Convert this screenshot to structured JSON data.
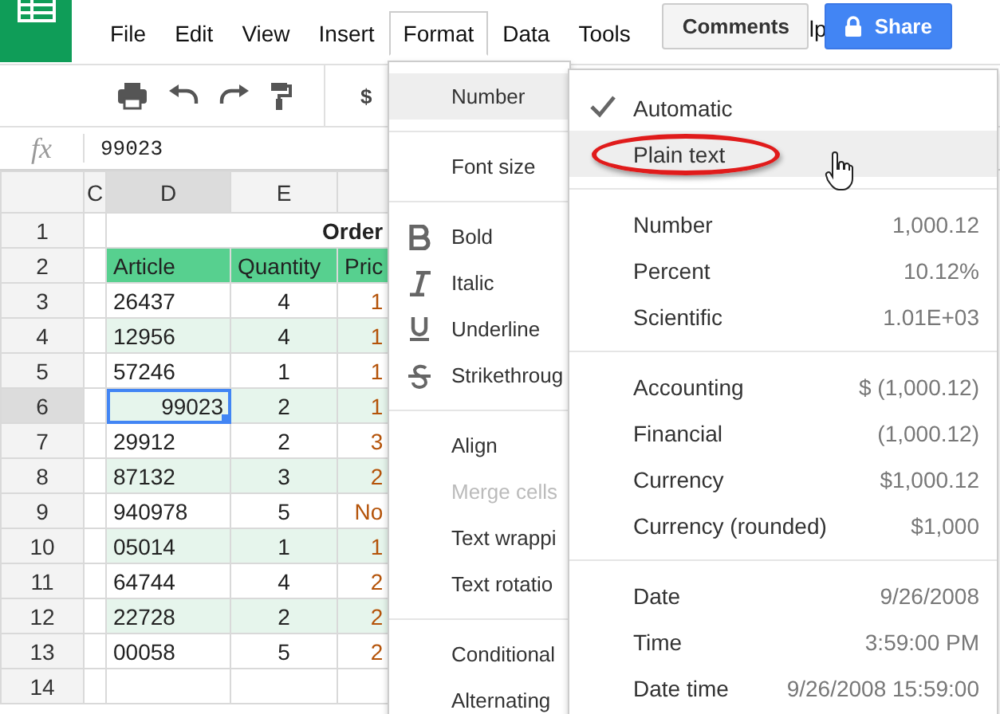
{
  "menubar": {
    "items": [
      {
        "label": "File",
        "open": false
      },
      {
        "label": "Edit",
        "open": false
      },
      {
        "label": "View",
        "open": false
      },
      {
        "label": "Insert",
        "open": false
      },
      {
        "label": "Format",
        "open": true
      },
      {
        "label": "Data",
        "open": false
      },
      {
        "label": "Tools",
        "open": false
      }
    ],
    "comments_button": "Comments",
    "partial_menu": "lp",
    "share_button": "Share"
  },
  "toolbar": {
    "currency_label": "$"
  },
  "formula_bar": {
    "label": "fx",
    "value": "99023"
  },
  "sheet": {
    "columns": [
      {
        "label": "C",
        "selected": false
      },
      {
        "label": "D",
        "selected": true
      },
      {
        "label": "E",
        "selected": false
      }
    ],
    "title_row": {
      "number": "1",
      "text": "Order"
    },
    "header_row": {
      "number": "2",
      "cells": [
        "Article",
        "Quantity",
        "Pric"
      ]
    },
    "rows": [
      {
        "number": "3",
        "selected": false,
        "article": {
          "text": "26437",
          "kind": "text"
        },
        "quantity": "4",
        "price": "1"
      },
      {
        "number": "4",
        "selected": false,
        "article": {
          "text": "12956",
          "kind": "text"
        },
        "quantity": "4",
        "price": "1"
      },
      {
        "number": "5",
        "selected": false,
        "article": {
          "text": "57246",
          "kind": "text"
        },
        "quantity": "1",
        "price": "1"
      },
      {
        "number": "6",
        "selected": true,
        "article": {
          "text": "99023",
          "kind": "number"
        },
        "quantity": "2",
        "price": "1"
      },
      {
        "number": "7",
        "selected": false,
        "article": {
          "text": "29912",
          "kind": "text"
        },
        "quantity": "2",
        "price": "3"
      },
      {
        "number": "8",
        "selected": false,
        "article": {
          "text": "87132",
          "kind": "text"
        },
        "quantity": "3",
        "price": "2"
      },
      {
        "number": "9",
        "selected": false,
        "article": {
          "text": "940978",
          "kind": "text"
        },
        "quantity": "5",
        "price": "No"
      },
      {
        "number": "10",
        "selected": false,
        "article": {
          "text": "05014",
          "kind": "text"
        },
        "quantity": "1",
        "price": "1"
      },
      {
        "number": "11",
        "selected": false,
        "article": {
          "text": "64744",
          "kind": "text"
        },
        "quantity": "4",
        "price": "2"
      },
      {
        "number": "12",
        "selected": false,
        "article": {
          "text": "22728",
          "kind": "text"
        },
        "quantity": "2",
        "price": "2"
      },
      {
        "number": "13",
        "selected": false,
        "article": {
          "text": "00058",
          "kind": "text"
        },
        "quantity": "5",
        "price": "2"
      }
    ],
    "empty_row_number": "14"
  },
  "format_menu": {
    "sections": [
      [
        {
          "label": "Number",
          "kind": "plain",
          "highlighted": true,
          "disabled": false
        }
      ],
      [
        {
          "label": "Font size",
          "kind": "plain",
          "highlighted": false,
          "disabled": false
        }
      ],
      [
        {
          "label": "Bold",
          "kind": "bold",
          "highlighted": false,
          "disabled": false
        },
        {
          "label": "Italic",
          "kind": "italic",
          "highlighted": false,
          "disabled": false
        },
        {
          "label": "Underline",
          "kind": "underline",
          "highlighted": false,
          "disabled": false
        },
        {
          "label": "Strikethroug",
          "kind": "strikethrough",
          "highlighted": false,
          "disabled": false
        }
      ],
      [
        {
          "label": "Align",
          "kind": "plain",
          "highlighted": false,
          "disabled": false
        },
        {
          "label": "Merge cells",
          "kind": "plain",
          "highlighted": false,
          "disabled": true
        },
        {
          "label": "Text wrappi",
          "kind": "plain",
          "highlighted": false,
          "disabled": false
        },
        {
          "label": "Text rotatio",
          "kind": "plain",
          "highlighted": false,
          "disabled": false
        }
      ],
      [
        {
          "label": "Conditional",
          "kind": "plain",
          "highlighted": false,
          "disabled": false
        },
        {
          "label": "Alternating",
          "kind": "plain",
          "highlighted": false,
          "disabled": false
        }
      ]
    ]
  },
  "number_submenu": {
    "sections": [
      [
        {
          "label": "Automatic",
          "checked": true,
          "highlighted": false,
          "circled": false
        },
        {
          "label": "Plain text",
          "checked": false,
          "highlighted": true,
          "circled": true
        }
      ],
      [
        {
          "label": "Number",
          "example": "1,000.12",
          "checked": false,
          "highlighted": false,
          "circled": false
        },
        {
          "label": "Percent",
          "example": "10.12%",
          "checked": false,
          "highlighted": false,
          "circled": false
        },
        {
          "label": "Scientific",
          "example": "1.01E+03",
          "checked": false,
          "highlighted": false,
          "circled": false
        }
      ],
      [
        {
          "label": "Accounting",
          "example": "$ (1,000.12)",
          "checked": false,
          "highlighted": false,
          "circled": false
        },
        {
          "label": "Financial",
          "example": "(1,000.12)",
          "checked": false,
          "highlighted": false,
          "circled": false
        },
        {
          "label": "Currency",
          "example": "$1,000.12",
          "checked": false,
          "highlighted": false,
          "circled": false
        },
        {
          "label": "Currency (rounded)",
          "example": "$1,000",
          "checked": false,
          "highlighted": false,
          "circled": false
        }
      ],
      [
        {
          "label": "Date",
          "example": "9/26/2008",
          "checked": false,
          "highlighted": false,
          "circled": false
        },
        {
          "label": "Time",
          "example": "3:59:00 PM",
          "checked": false,
          "highlighted": false,
          "circled": false
        },
        {
          "label": "Date time",
          "example": "9/26/2008 15:59:00",
          "checked": false,
          "highlighted": false,
          "circled": false
        }
      ]
    ]
  }
}
